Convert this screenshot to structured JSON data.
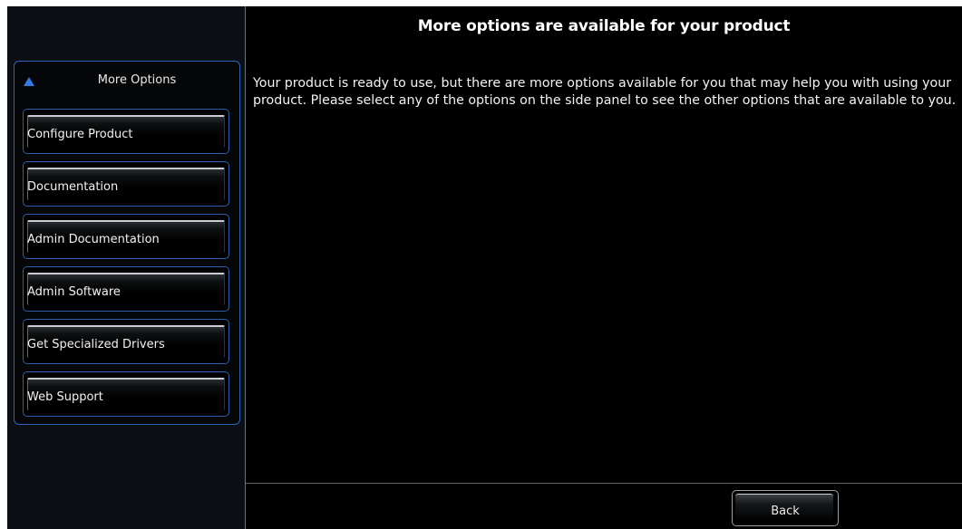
{
  "sidebar": {
    "panel_title": "More Options",
    "header_icon": "triangle-up-icon",
    "items": [
      {
        "label": "Configure Product"
      },
      {
        "label": "Documentation"
      },
      {
        "label": "Admin Documentation"
      },
      {
        "label": "Admin Software"
      },
      {
        "label": "Get Specialized Drivers"
      },
      {
        "label": "Web Support"
      }
    ]
  },
  "main": {
    "title": "More options are available for your product",
    "body": "Your product is ready to use, but there are more options available for you that may help you with using your product.  Please select any of the options on the side panel to see the other options that are available to you."
  },
  "footer": {
    "back_label": "Back"
  },
  "colors": {
    "accent_blue": "#2f7ce6",
    "background": "#000000"
  }
}
